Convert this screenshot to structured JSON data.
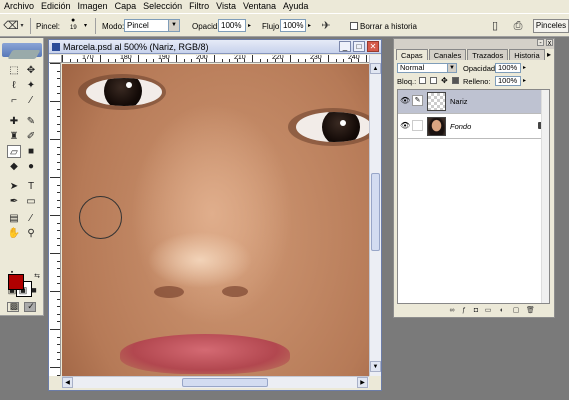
{
  "menubar": {
    "items": [
      "Archivo",
      "Edición",
      "Imagen",
      "Capa",
      "Selección",
      "Filtro",
      "Vista",
      "Ventana",
      "Ayuda"
    ]
  },
  "options": {
    "brush_label": "Pincel:",
    "brush_size": "19",
    "mode_label": "Modo:",
    "mode_value": "Pincel",
    "opacity_label": "Opacid.:",
    "opacity_value": "100%",
    "flow_label": "Flujo:",
    "flow_value": "100%",
    "erase_history_label": "Borrar a historia",
    "brushes_tab": "Pinceles"
  },
  "document": {
    "title": "Marcela.psd al 500% (Nariz, RGB/8)",
    "ruler_numbers": [
      "170",
      "180",
      "190",
      "200",
      "210",
      "220",
      "230",
      "240"
    ]
  },
  "colors": {
    "foreground": "#b00000",
    "background": "#ffffff"
  },
  "layers_panel": {
    "tabs": [
      "Capas",
      "Canales",
      "Trazados",
      "Historia"
    ],
    "blend_mode": "Normal",
    "opacity_label": "Opacidad:",
    "opacity_value": "100%",
    "lock_label": "Bloq.:",
    "fill_label": "Relleno:",
    "fill_value": "100%",
    "layers": [
      {
        "name": "Nariz",
        "selected": true
      },
      {
        "name": "Fondo",
        "selected": false,
        "locked": true
      }
    ]
  }
}
